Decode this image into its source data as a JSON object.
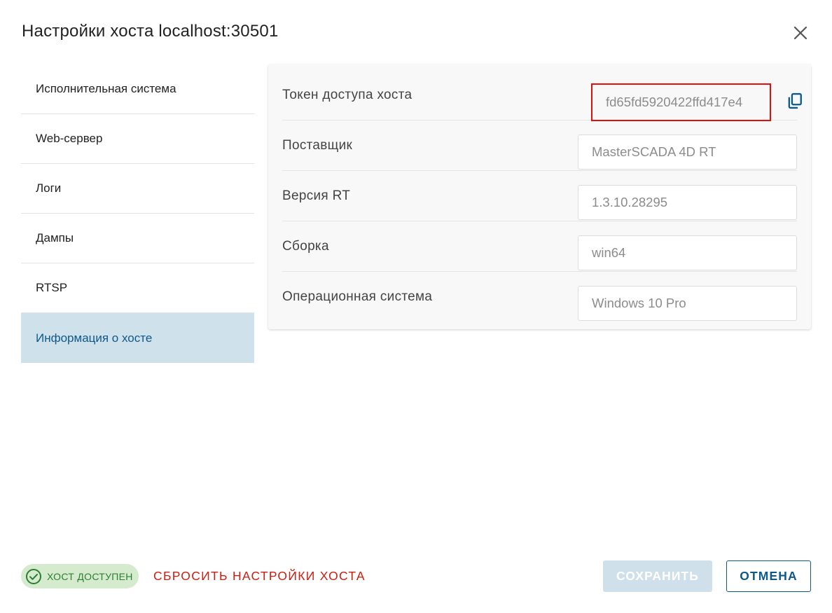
{
  "dialog": {
    "title": "Настройки хоста localhost:30501"
  },
  "sidebar": {
    "items": [
      {
        "label": "Исполнительная система"
      },
      {
        "label": "Web-сервер"
      },
      {
        "label": "Логи"
      },
      {
        "label": "Дампы"
      },
      {
        "label": "RTSP"
      },
      {
        "label": "Информация о хосте",
        "active": true
      }
    ]
  },
  "host_info": {
    "rows": [
      {
        "label": "Токен доступа хоста",
        "value": "fd65fd5920422ffd417e4"
      },
      {
        "label": "Поставщик",
        "value": "MasterSCADA 4D RT"
      },
      {
        "label": "Версия RT",
        "value": "1.3.10.28295"
      },
      {
        "label": "Сборка",
        "value": "win64"
      },
      {
        "label": "Операционная система",
        "value": "Windows 10 Pro"
      }
    ]
  },
  "footer": {
    "status_label": "ХОСТ ДОСТУПЕН",
    "reset_label": "СБРОСИТЬ НАСТРОЙКИ ХОСТА",
    "save_label": "СОХРАНИТЬ",
    "cancel_label": "ОТМЕНА"
  },
  "icons": {
    "close": "close-icon",
    "copy": "copy-icon",
    "status": "check-circle-icon"
  },
  "colors": {
    "accent": "#0d5a8a",
    "active_bg": "#cfe1ea",
    "danger": "#cc1d10",
    "success": "#2e7d32",
    "success_bg": "#d4ebce",
    "highlight_border": "#e01010"
  }
}
